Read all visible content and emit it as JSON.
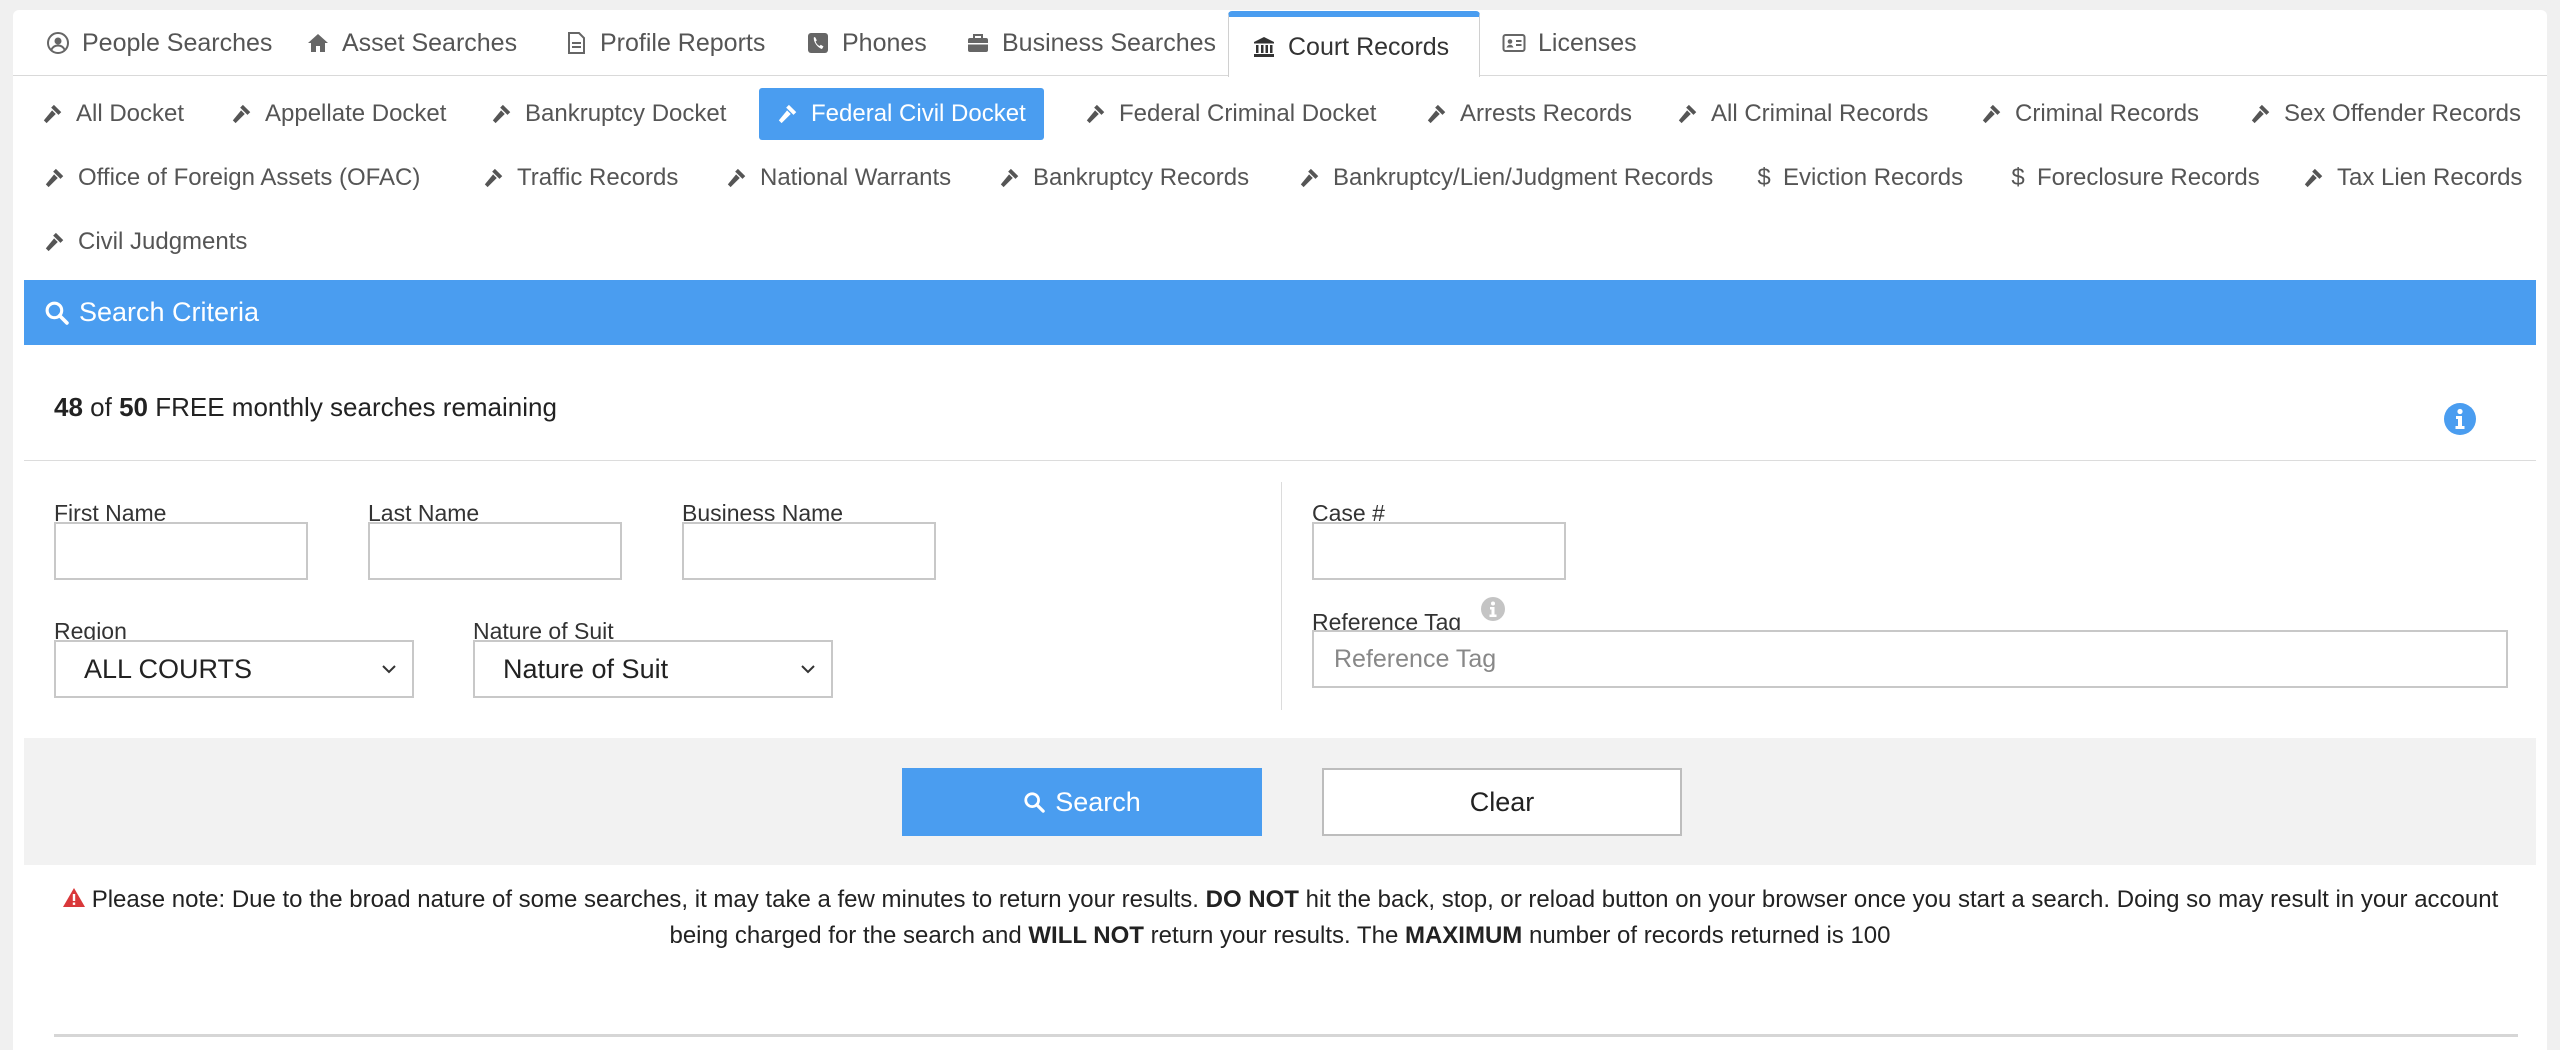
{
  "main_tabs": [
    {
      "label": "People Searches",
      "icon": "user-circle-icon"
    },
    {
      "label": "Asset Searches",
      "icon": "home-icon"
    },
    {
      "label": "Profile Reports",
      "icon": "document-icon"
    },
    {
      "label": "Phones",
      "icon": "phone-icon"
    },
    {
      "label": "Business Searches",
      "icon": "briefcase-icon"
    },
    {
      "label": "Court Records",
      "icon": "courthouse-icon",
      "active": true
    },
    {
      "label": "Licenses",
      "icon": "id-card-icon"
    }
  ],
  "sub_tabs": [
    {
      "label": "All Docket",
      "icon": "gavel-icon"
    },
    {
      "label": "Appellate Docket",
      "icon": "gavel-icon"
    },
    {
      "label": "Bankruptcy Docket",
      "icon": "gavel-icon"
    },
    {
      "label": "Federal Civil Docket",
      "icon": "gavel-icon",
      "active": true
    },
    {
      "label": "Federal Criminal Docket",
      "icon": "gavel-icon"
    },
    {
      "label": "Arrests Records",
      "icon": "gavel-icon"
    },
    {
      "label": "All Criminal Records",
      "icon": "gavel-icon"
    },
    {
      "label": "Criminal Records",
      "icon": "gavel-icon"
    },
    {
      "label": "Sex Offender Records",
      "icon": "gavel-icon"
    },
    {
      "label": "Office of Foreign Assets (OFAC)",
      "icon": "gavel-icon"
    },
    {
      "label": "Traffic Records",
      "icon": "gavel-icon"
    },
    {
      "label": "National Warrants",
      "icon": "gavel-icon"
    },
    {
      "label": "Bankruptcy Records",
      "icon": "gavel-icon"
    },
    {
      "label": "Bankruptcy/Lien/Judgment Records",
      "icon": "gavel-icon"
    },
    {
      "label": "Eviction Records",
      "icon": "dollar-icon"
    },
    {
      "label": "Foreclosure Records",
      "icon": "dollar-icon"
    },
    {
      "label": "Tax Lien Records",
      "icon": "gavel-icon"
    },
    {
      "label": "Civil Judgments",
      "icon": "gavel-icon"
    }
  ],
  "criteria": {
    "title": "Search Criteria",
    "quota": {
      "used": "48",
      "of": "of",
      "total": "50",
      "suffix": "FREE monthly searches remaining"
    }
  },
  "form": {
    "first_name_label": "First Name",
    "first_name_value": "",
    "last_name_label": "Last Name",
    "last_name_value": "",
    "business_name_label": "Business Name",
    "business_name_value": "",
    "case_label": "Case #",
    "case_value": "",
    "region_label": "Region",
    "region_value": "ALL COURTS",
    "nature_label": "Nature of Suit",
    "nature_value": "Nature of Suit",
    "ref_tag_label": "Reference Tag",
    "ref_tag_placeholder": "Reference Tag"
  },
  "buttons": {
    "search": "Search",
    "clear": "Clear"
  },
  "notice": {
    "p1": "Please note: Due to the broad nature of some searches, it may take a few minutes to return your results.",
    "b1": "DO NOT",
    "p2": "hit the back, stop, or reload button on your browser once you start a search. Doing so may result in your account being charged for the search and",
    "b2": "WILL NOT",
    "p3": "return your results. The",
    "b3": "MAXIMUM",
    "p4": "number of records returned is 100"
  },
  "colors": {
    "accent": "#4a9df0",
    "warning": "#d9383a"
  }
}
